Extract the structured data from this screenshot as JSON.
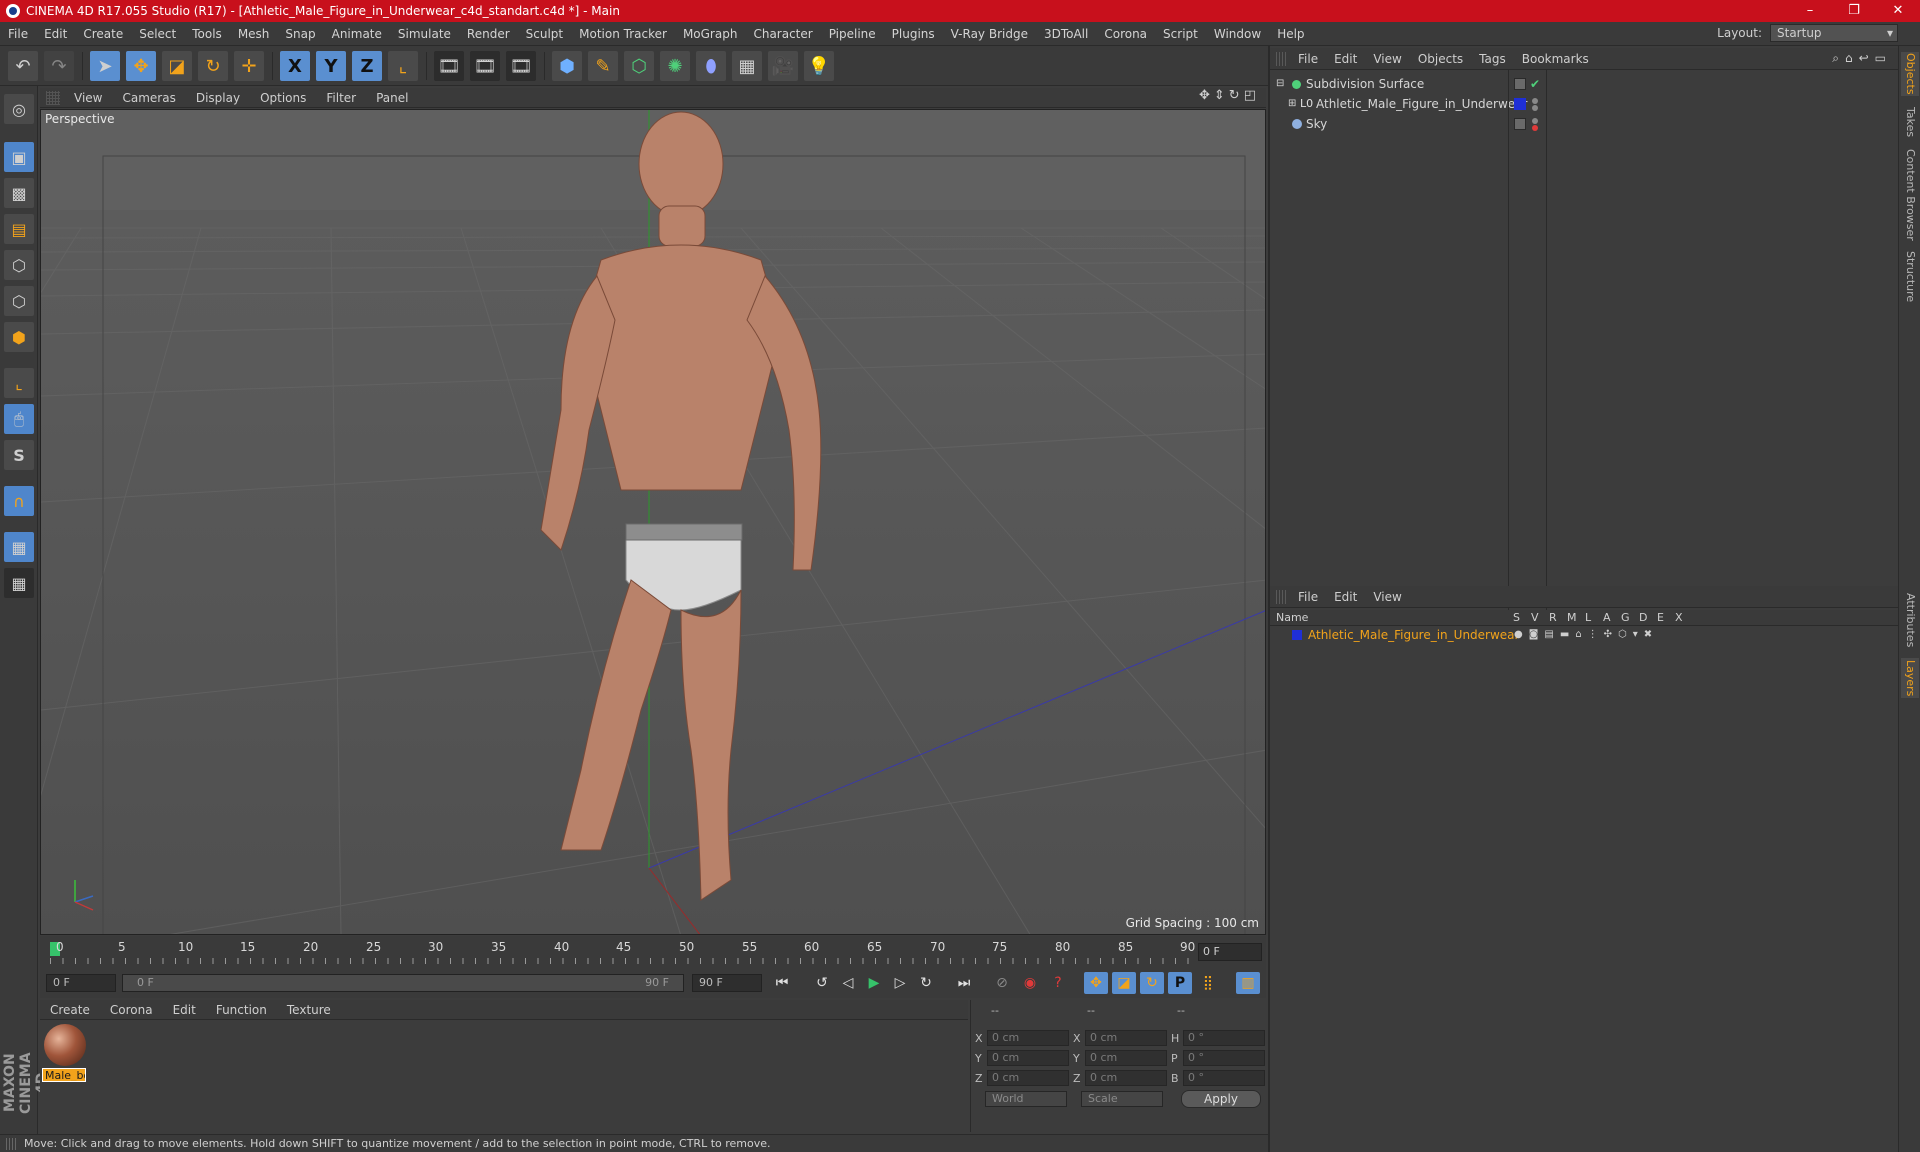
{
  "window": {
    "title": "CINEMA 4D R17.055 Studio (R17) - [Athletic_Male_Figure_in_Underwear_c4d_standart.c4d *] - Main",
    "controls": [
      "–",
      "❐",
      "✕"
    ]
  },
  "menu": {
    "items": [
      "File",
      "Edit",
      "Create",
      "Select",
      "Tools",
      "Mesh",
      "Snap",
      "Animate",
      "Simulate",
      "Render",
      "Sculpt",
      "Motion Tracker",
      "MoGraph",
      "Character",
      "Pipeline",
      "Plugins",
      "V-Ray Bridge",
      "3DToAll",
      "Corona",
      "Script",
      "Window",
      "Help"
    ],
    "layout_label": "Layout:",
    "layout_value": "Startup"
  },
  "toolbar": {
    "axis_x": "X",
    "axis_y": "Y",
    "axis_z": "Z"
  },
  "viewport": {
    "menu": [
      "View",
      "Cameras",
      "Display",
      "Options",
      "Filter",
      "Panel"
    ],
    "camera_label": "Perspective",
    "grid_spacing": "Grid Spacing : 100 cm"
  },
  "timeline": {
    "frames": [
      "0",
      "5",
      "10",
      "15",
      "20",
      "25",
      "30",
      "35",
      "40",
      "45",
      "50",
      "55",
      "60",
      "65",
      "70",
      "75",
      "80",
      "85",
      "90"
    ],
    "current_frame": "0 F",
    "start_field": "0 F",
    "range_start": "0 F",
    "range_end": "90 F",
    "end_field": "90 F"
  },
  "material_manager": {
    "menu": [
      "Create",
      "Corona",
      "Edit",
      "Function",
      "Texture"
    ],
    "materials": [
      {
        "name": "Male_bo"
      }
    ]
  },
  "coordinates": {
    "header": [
      "--",
      "--",
      "--"
    ],
    "rows": [
      {
        "pos_label": "X",
        "pos": "0 cm",
        "size_label": "X",
        "size": "0 cm",
        "rot_label": "H",
        "rot": "0 °"
      },
      {
        "pos_label": "Y",
        "pos": "0 cm",
        "size_label": "Y",
        "size": "0 cm",
        "rot_label": "P",
        "rot": "0 °"
      },
      {
        "pos_label": "Z",
        "pos": "0 cm",
        "size_label": "Z",
        "size": "0 cm",
        "rot_label": "B",
        "rot": "0 °"
      }
    ],
    "mode": "World",
    "transform": "Scale",
    "apply": "Apply"
  },
  "status_bar": {
    "text": "Move: Click and drag to move elements. Hold down SHIFT to quantize movement / add to the selection in point mode, CTRL to remove."
  },
  "object_manager": {
    "menu": [
      "File",
      "Edit",
      "View",
      "Objects",
      "Tags",
      "Bookmarks"
    ],
    "objects": [
      {
        "name": "Subdivision Surface",
        "icon": "subdivision-icon"
      },
      {
        "name": "Athletic_Male_Figure_in_Underwear",
        "icon": "null-object-icon"
      },
      {
        "name": "Sky",
        "icon": "sky-icon"
      }
    ]
  },
  "layer_manager": {
    "menu": [
      "File",
      "Edit",
      "View"
    ],
    "columns": [
      "Name",
      "S",
      "V",
      "R",
      "M",
      "L",
      "A",
      "G",
      "D",
      "E",
      "X"
    ],
    "layers": [
      {
        "name": "Athletic_Male_Figure_in_Underwear",
        "color": "#1f2fd6"
      }
    ]
  },
  "side_tabs": {
    "top": [
      "Objects",
      "Takes",
      "Content Browser",
      "Structure"
    ],
    "bottom": [
      "Attributes",
      "Layers"
    ]
  },
  "colors": {
    "title_bar": "#c8101c",
    "accent_orange": "#f2a31b",
    "selected_blue": "#5a8fd0",
    "layer_color": "#1f2fd6"
  }
}
